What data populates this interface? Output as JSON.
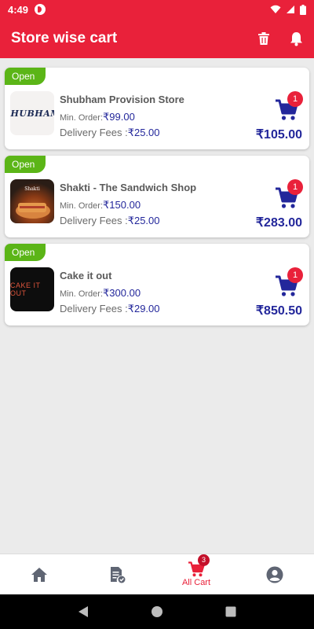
{
  "status_bar": {
    "time": "4:49"
  },
  "app_bar": {
    "title": "Store wise cart",
    "icons": [
      "delete-icon",
      "bell-icon"
    ]
  },
  "stores": [
    {
      "status": "Open",
      "name": "Shubham Provision Store",
      "logo_text": "SHUBHAM",
      "min_order_label": "Min. Order:",
      "min_order": "₹99.00",
      "delivery_label": "Delivery Fees :",
      "delivery_fee": "₹25.00",
      "cart_count": "1",
      "total": "₹105.00"
    },
    {
      "status": "Open",
      "name": "Shakti - The Sandwich Shop",
      "logo_text": "",
      "min_order_label": "Min. Order:",
      "min_order": "₹150.00",
      "delivery_label": "Delivery Fees :",
      "delivery_fee": "₹25.00",
      "cart_count": "1",
      "total": "₹283.00"
    },
    {
      "status": "Open",
      "name": "Cake it out",
      "logo_text": "CAKE IT OUT",
      "min_order_label": "Min. Order:",
      "min_order": "₹300.00",
      "delivery_label": "Delivery Fees :",
      "delivery_fee": "₹29.00",
      "cart_count": "1",
      "total": "₹850.50"
    }
  ],
  "bottom_nav": {
    "items": [
      {
        "icon": "home-icon",
        "label": ""
      },
      {
        "icon": "orders-icon",
        "label": ""
      },
      {
        "icon": "cart-icon",
        "label": "All Cart",
        "badge": "3",
        "active": true
      },
      {
        "icon": "profile-icon",
        "label": ""
      }
    ]
  },
  "colors": {
    "primary": "#e9213a",
    "open_badge": "#5bb517",
    "price": "#23279b",
    "background": "#ebebeb"
  }
}
